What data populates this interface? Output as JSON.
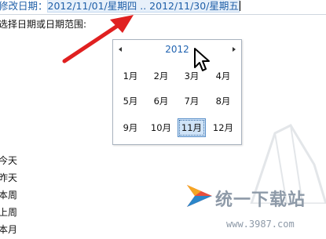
{
  "search": {
    "prefix": "修改日期：",
    "range": "2012/11/01/星期四 .. 2012/11/30/星期五"
  },
  "prompt": "选择日期或日期范围:",
  "calendar": {
    "year": "2012",
    "months": [
      "1月",
      "2月",
      "3月",
      "4月",
      "5月",
      "6月",
      "7月",
      "8月",
      "9月",
      "10月",
      "11月",
      "12月"
    ],
    "selected_month": "11月"
  },
  "quick_options": [
    "今天",
    "昨天",
    "本周",
    "上周",
    "本月"
  ],
  "watermark": {
    "brand": "统一下载站",
    "url": "www.3987.com"
  },
  "colors": {
    "accent": "#1f62b0",
    "annotation_arrow": "#e02020",
    "selection_bg": "#cfe3f7",
    "selection_border": "#5a8fc8"
  }
}
